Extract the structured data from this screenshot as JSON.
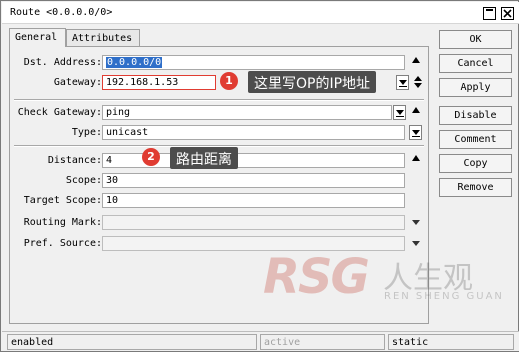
{
  "window": {
    "title": "Route <0.0.0.0/0>"
  },
  "tabs": [
    {
      "label": "General",
      "active": true
    },
    {
      "label": "Attributes",
      "active": false
    }
  ],
  "form": {
    "dst_address": {
      "label": "Dst. Address:",
      "value": "0.0.0.0/0"
    },
    "gateway": {
      "label": "Gateway:",
      "value": "192.168.1.53"
    },
    "check_gateway": {
      "label": "Check Gateway:",
      "value": "ping"
    },
    "type": {
      "label": "Type:",
      "value": "unicast"
    },
    "distance": {
      "label": "Distance:",
      "value": "4"
    },
    "scope": {
      "label": "Scope:",
      "value": "30"
    },
    "target_scope": {
      "label": "Target Scope:",
      "value": "10"
    },
    "routing_mark": {
      "label": "Routing Mark:",
      "value": ""
    },
    "pref_source": {
      "label": "Pref. Source:",
      "value": ""
    }
  },
  "buttons": [
    "OK",
    "Cancel",
    "Apply",
    "Disable",
    "Comment",
    "Copy",
    "Remove"
  ],
  "annotations": [
    {
      "number": "1",
      "text": "这里写OP的IP地址"
    },
    {
      "number": "2",
      "text": "路由距离"
    }
  ],
  "status": {
    "enabled": "enabled",
    "active": "active",
    "static": "static"
  },
  "watermark": {
    "logo": "RSG",
    "cn": "人生观",
    "en": "REN SHENG GUAN"
  },
  "colors": {
    "selection": "#2f6fc9",
    "badge": "#e03c32",
    "tooltip_bg": "#4d4d4d",
    "gateway_border": "#e03c32"
  }
}
